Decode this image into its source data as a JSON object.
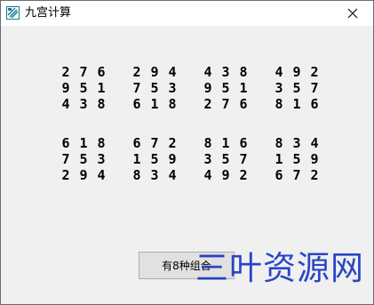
{
  "window": {
    "title": "九宫计算"
  },
  "icons": {
    "app": "app-icon",
    "close": "close-icon"
  },
  "grids": [
    {
      "rows": [
        [
          "2",
          "7",
          "6"
        ],
        [
          "9",
          "5",
          "1"
        ],
        [
          "4",
          "3",
          "8"
        ]
      ]
    },
    {
      "rows": [
        [
          "2",
          "9",
          "4"
        ],
        [
          "7",
          "5",
          "3"
        ],
        [
          "6",
          "1",
          "8"
        ]
      ]
    },
    {
      "rows": [
        [
          "4",
          "3",
          "8"
        ],
        [
          "9",
          "5",
          "1"
        ],
        [
          "2",
          "7",
          "6"
        ]
      ]
    },
    {
      "rows": [
        [
          "4",
          "9",
          "2"
        ],
        [
          "3",
          "5",
          "7"
        ],
        [
          "8",
          "1",
          "6"
        ]
      ]
    },
    {
      "rows": [
        [
          "6",
          "1",
          "8"
        ],
        [
          "7",
          "5",
          "3"
        ],
        [
          "2",
          "9",
          "4"
        ]
      ]
    },
    {
      "rows": [
        [
          "6",
          "7",
          "2"
        ],
        [
          "1",
          "5",
          "9"
        ],
        [
          "8",
          "3",
          "4"
        ]
      ]
    },
    {
      "rows": [
        [
          "8",
          "1",
          "6"
        ],
        [
          "3",
          "5",
          "7"
        ],
        [
          "4",
          "9",
          "2"
        ]
      ]
    },
    {
      "rows": [
        [
          "8",
          "3",
          "4"
        ],
        [
          "1",
          "5",
          "9"
        ],
        [
          "6",
          "7",
          "2"
        ]
      ]
    }
  ],
  "button": {
    "label": "有8种组合"
  },
  "watermark": {
    "text": "三叶资源网"
  }
}
